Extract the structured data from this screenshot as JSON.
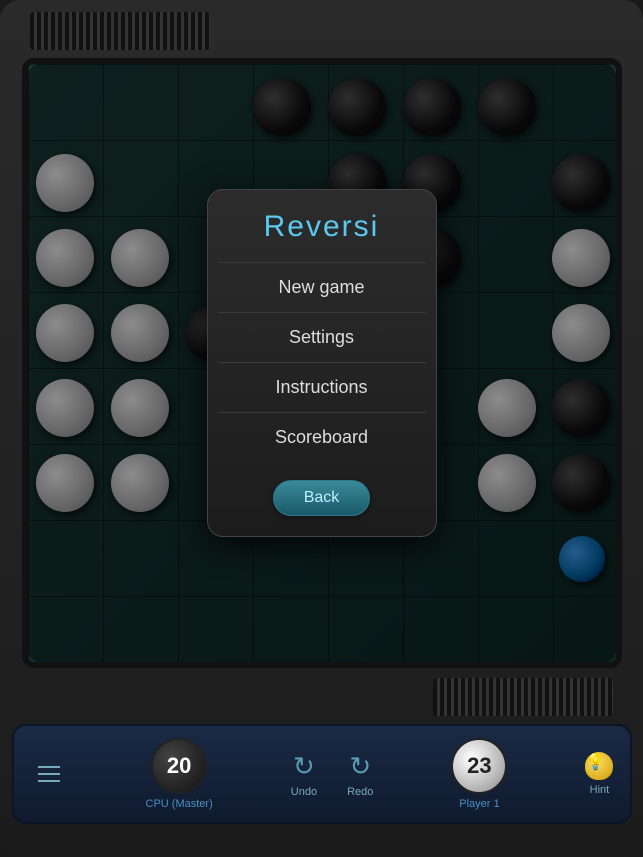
{
  "title": "Reversi",
  "menu": {
    "title": "Reversi",
    "items": [
      {
        "label": "New game",
        "id": "new-game"
      },
      {
        "label": "Settings",
        "id": "settings"
      },
      {
        "label": "Instructions",
        "id": "instructions"
      },
      {
        "label": "Scoreboard",
        "id": "scoreboard"
      }
    ],
    "back_label": "Back"
  },
  "scores": {
    "cpu": {
      "value": "20",
      "label": "CPU (Master)"
    },
    "player": {
      "value": "23",
      "label": "Player 1"
    }
  },
  "controls": {
    "undo_label": "Undo",
    "redo_label": "Redo",
    "hint_label": "Hint"
  },
  "board": {
    "pieces": [
      {
        "row": 1,
        "col": 3,
        "color": "black"
      },
      {
        "row": 1,
        "col": 4,
        "color": "black"
      },
      {
        "row": 1,
        "col": 5,
        "color": "black"
      },
      {
        "row": 1,
        "col": 6,
        "color": "black"
      },
      {
        "row": 2,
        "col": 1,
        "color": "white"
      },
      {
        "row": 2,
        "col": 4,
        "color": "black"
      },
      {
        "row": 2,
        "col": 5,
        "color": "black"
      },
      {
        "row": 2,
        "col": 7,
        "color": "black"
      },
      {
        "row": 3,
        "col": 1,
        "color": "white"
      },
      {
        "row": 3,
        "col": 2,
        "color": "white"
      },
      {
        "row": 3,
        "col": 5,
        "color": "black"
      },
      {
        "row": 3,
        "col": 7,
        "color": "white"
      },
      {
        "row": 4,
        "col": 1,
        "color": "white"
      },
      {
        "row": 4,
        "col": 2,
        "color": "white"
      },
      {
        "row": 4,
        "col": 3,
        "color": "black"
      },
      {
        "row": 4,
        "col": 7,
        "color": "white"
      },
      {
        "row": 5,
        "col": 1,
        "color": "white"
      },
      {
        "row": 5,
        "col": 2,
        "color": "white"
      },
      {
        "row": 5,
        "col": 6,
        "color": "white"
      },
      {
        "row": 5,
        "col": 7,
        "color": "black"
      },
      {
        "row": 6,
        "col": 1,
        "color": "white"
      },
      {
        "row": 6,
        "col": 2,
        "color": "white"
      },
      {
        "row": 6,
        "col": 7,
        "color": "black"
      },
      {
        "row": 7,
        "col": 7,
        "color": "blue"
      },
      {
        "row": 6,
        "col": 6,
        "color": "white"
      }
    ]
  }
}
